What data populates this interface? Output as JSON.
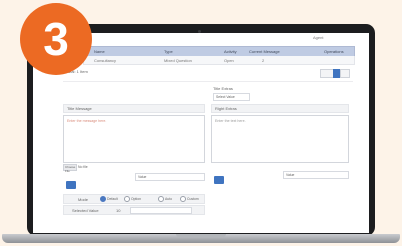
{
  "badge": {
    "number": "3"
  },
  "colors": {
    "badge": "#ec6a23",
    "table_header": "#bfcbe3",
    "primary_button": "#3f74c0",
    "background": "#fdf3e8"
  },
  "header": {
    "user_menu": "Agent"
  },
  "table": {
    "columns": [
      "Name",
      "Type",
      "Activity",
      "Current Message",
      "Operations"
    ],
    "rows": [
      [
        "Consultancy",
        "Mixed Question",
        "Open",
        "2",
        ""
      ]
    ]
  },
  "toolbar": {
    "count_text": "Total: 1 Item"
  },
  "form": {
    "left_title": "Title Message",
    "right_title": "Title Extras",
    "left_section": "Left Message",
    "right_section": "Right Extras",
    "select_label": "Select Value",
    "left_placeholder": "Enter the message here.",
    "right_placeholder": "Enter the text here.",
    "file_button": "Choose File",
    "file_status": "No file",
    "input_left": "Value",
    "input_right": "Value",
    "radio_label": "Mode",
    "radio_options": [
      "Default",
      "Option",
      "Auto",
      "Custom"
    ],
    "bottom_label": "Selected Value",
    "bottom_value": "10"
  },
  "icons": {
    "close": "close-icon",
    "prev": "chevron-left-icon",
    "next": "chevron-right-icon"
  }
}
